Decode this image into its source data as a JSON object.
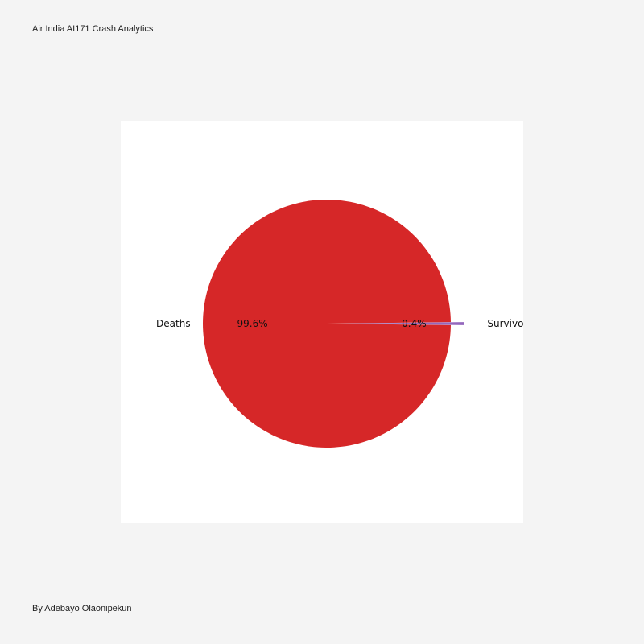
{
  "page": {
    "title": "Air India AI171 Crash Analytics",
    "credit": "By Adebayo Olaonipekun"
  },
  "chart_data": {
    "type": "pie",
    "categories": [
      "Deaths",
      "Survivors"
    ],
    "values": [
      260,
      1
    ],
    "percent_labels": [
      "99.6%",
      "0.4%"
    ],
    "colors": [
      "#d62728",
      "#9467bd"
    ],
    "exploded": [
      false,
      true
    ],
    "title": "",
    "legend": "none"
  }
}
